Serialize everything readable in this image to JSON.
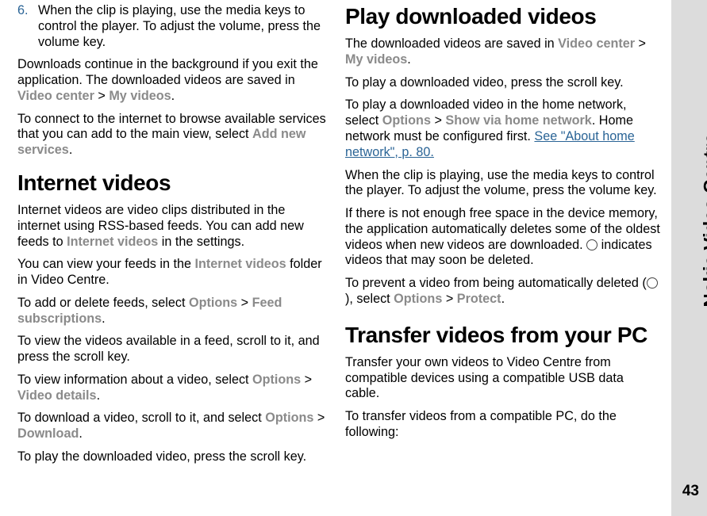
{
  "sideLabel": "Nokia Video Centre",
  "pageNumber": "43",
  "left": {
    "step6num": "6.",
    "step6": "When the clip is playing, use the media keys to control the player. To adjust the volume, press the volume key.",
    "p1a": "Downloads continue in the background if you exit the application. The downloaded videos are saved in ",
    "vc": "Video center",
    "gt": " > ",
    "mv": "My videos",
    "dot": ".",
    "p2a": "To connect to the internet to browse available services that you can add to the main view, select ",
    "addnew": "Add new services",
    "h1": "Internet videos",
    "p3": "Internet videos are video clips distributed in the internet using RSS-based feeds. You can add new feeds to ",
    "intvid": "Internet videos",
    "p3b": " in the settings.",
    "p4a": "You can view your feeds in the ",
    "p4b": " folder in Video Centre.",
    "p5a": "To add or delete feeds, select ",
    "options": "Options",
    "feedsubs": "Feed subscriptions",
    "p6": "To view the videos available in a feed, scroll to it, and press the scroll key.",
    "p7a": "To view information about a video, select ",
    "viddet": "Video details",
    "p8a": "To download a video, scroll to it, and select ",
    "download": "Download",
    "p9": "To play the downloaded video, press the scroll key."
  },
  "right": {
    "h1": "Play downloaded videos",
    "p1a": "The downloaded videos are saved in ",
    "vc": "Video center",
    "gt": " > ",
    "mv": "My videos",
    "dot": ".",
    "p2": "To play a downloaded video, press the scroll key.",
    "p3a": "To play a downloaded video in the home network, select ",
    "options": "Options",
    "showvia": "Show via home network",
    "p3b": ". Home network must be configured first. ",
    "link": "See \"About home network\", p. 80.",
    "p4": "When the clip is playing, use the media keys to control the player. To adjust the volume, press the volume key.",
    "p5a": "If there is not enough free space in the device memory, the application automatically deletes some of the oldest videos when new videos are downloaded. ",
    "p5b": " indicates videos that may soon be deleted.",
    "p6a": "To prevent a video from being automatically deleted (",
    "p6b": "), select ",
    "protect": "Protect",
    "h2": "Transfer videos from your PC",
    "p7": "Transfer your own videos to Video Centre from compatible devices using a compatible USB data cable.",
    "p8": "To transfer videos from a compatible PC, do the following:"
  }
}
